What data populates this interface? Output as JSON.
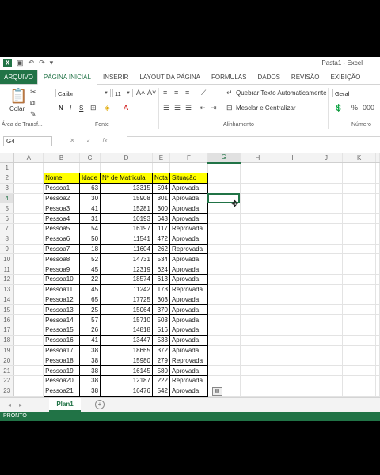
{
  "window": {
    "title": "Pasta1 - Excel"
  },
  "qat": {
    "save_icon": "save-icon",
    "undo_icon": "undo-icon",
    "redo_icon": "redo-icon"
  },
  "tabs": [
    "ARQUIVO",
    "PÁGINA INICIAL",
    "INSERIR",
    "LAYOUT DA PÁGINA",
    "FÓRMULAS",
    "DADOS",
    "REVISÃO",
    "EXIBIÇÃO"
  ],
  "ribbon": {
    "paste_label": "Colar",
    "clipboard_group": "Área de Transf...",
    "font_name": "Calibri",
    "font_size": "11",
    "font_group": "Fonte",
    "bold": "N",
    "italic": "I",
    "underline": "S",
    "wrap_text": "Quebrar Texto Automaticamente",
    "merge_center": "Mesclar e Centralizar",
    "alignment_group": "Alinhamento",
    "number_format": "Geral",
    "number_group": "Número"
  },
  "formula_bar": {
    "name_box": "G4",
    "fx": "fx",
    "value": ""
  },
  "columns": [
    "A",
    "B",
    "C",
    "D",
    "E",
    "F",
    "G",
    "H",
    "I",
    "J",
    "K"
  ],
  "selected_cell": "G4",
  "table": {
    "headers": [
      "Nome",
      "Idade",
      "Nº de Matricula",
      "Nota",
      "Situação"
    ],
    "rows": [
      [
        "Pessoa1",
        "63",
        "13315",
        "594",
        "Aprovada"
      ],
      [
        "Pessoa2",
        "30",
        "15908",
        "301",
        "Aprovada"
      ],
      [
        "Pessoa3",
        "41",
        "15281",
        "300",
        "Aprovada"
      ],
      [
        "Pessoa4",
        "31",
        "10193",
        "643",
        "Aprovada"
      ],
      [
        "Pessoa5",
        "54",
        "16197",
        "117",
        "Reprovada"
      ],
      [
        "Pessoa6",
        "50",
        "11541",
        "472",
        "Aprovada"
      ],
      [
        "Pessoa7",
        "18",
        "11604",
        "262",
        "Reprovada"
      ],
      [
        "Pessoa8",
        "52",
        "14731",
        "534",
        "Aprovada"
      ],
      [
        "Pessoa9",
        "45",
        "12319",
        "624",
        "Aprovada"
      ],
      [
        "Pessoa10",
        "22",
        "18574",
        "613",
        "Aprovada"
      ],
      [
        "Pessoa11",
        "45",
        "11242",
        "173",
        "Reprovada"
      ],
      [
        "Pessoa12",
        "65",
        "17725",
        "303",
        "Aprovada"
      ],
      [
        "Pessoa13",
        "25",
        "15064",
        "370",
        "Aprovada"
      ],
      [
        "Pessoa14",
        "57",
        "15710",
        "503",
        "Aprovada"
      ],
      [
        "Pessoa15",
        "26",
        "14818",
        "516",
        "Aprovada"
      ],
      [
        "Pessoa16",
        "41",
        "13447",
        "533",
        "Aprovada"
      ],
      [
        "Pessoa17",
        "38",
        "18665",
        "372",
        "Aprovada"
      ],
      [
        "Pessoa18",
        "38",
        "15980",
        "279",
        "Reprovada"
      ],
      [
        "Pessoa19",
        "38",
        "16145",
        "580",
        "Aprovada"
      ],
      [
        "Pessoa20",
        "38",
        "12187",
        "222",
        "Reprovada"
      ],
      [
        "Pessoa21",
        "38",
        "16476",
        "542",
        "Aprovada"
      ]
    ]
  },
  "sheets": {
    "active": "Plan1"
  },
  "status": {
    "text": "PRONTO"
  },
  "colors": {
    "excel_green": "#217346",
    "header_fill": "#ffff00"
  }
}
